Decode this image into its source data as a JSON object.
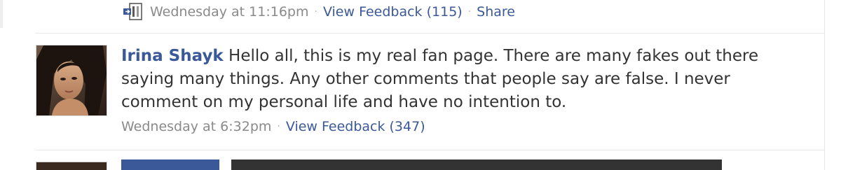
{
  "previous_story": {
    "timestamp": "Wednesday at 11:16pm",
    "feedback_link": "View Feedback (115)",
    "share_link": "Share",
    "separator": "·"
  },
  "story": {
    "author": "Irina Shayk",
    "message": "Hello all, this is my real fan page. There are many fakes out there saying many things. Any other comments that people say are false. I never comment on my personal life and have no intention to.",
    "timestamp": "Wednesday at 6:32pm",
    "feedback_link": "View Feedback (347)",
    "separator": "·"
  },
  "icons": {
    "note": "note-icon",
    "avatar": "profile-photo"
  },
  "colors": {
    "link": "#3b5998",
    "meta": "#8a8a8a",
    "text": "#333333"
  }
}
